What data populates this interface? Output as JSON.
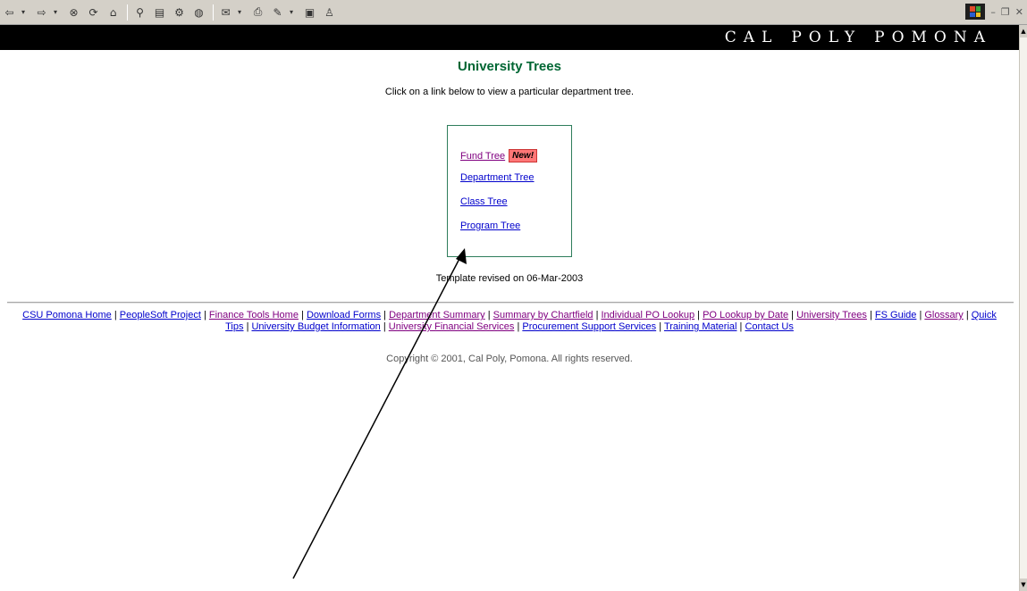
{
  "toolbar": {
    "icons": [
      "back-icon",
      "forward-icon",
      "stop-icon",
      "refresh-icon",
      "home-icon",
      "search-icon",
      "favorites-icon",
      "history-icon",
      "media-icon",
      "mail-icon",
      "print-icon",
      "edit-icon",
      "discuss-icon",
      "messenger-icon"
    ],
    "window_controls": {
      "minimize": "–",
      "restore": "❐",
      "close": "✕"
    }
  },
  "banner": {
    "words": [
      "CAL",
      "POLY",
      "POMONA"
    ]
  },
  "page": {
    "title": "University Trees",
    "intro": "Click on a link below to view a particular department tree.",
    "revised": "Template revised on 06-Mar-2003",
    "copyright": "Copyright © 2001, Cal Poly, Pomona. All rights reserved."
  },
  "trees": [
    {
      "label": "Fund Tree",
      "badge": "New!",
      "visited": true
    },
    {
      "label": "Department Tree",
      "badge": "",
      "visited": false
    },
    {
      "label": "Class Tree",
      "badge": "",
      "visited": false
    },
    {
      "label": "Program Tree",
      "badge": "",
      "visited": false
    }
  ],
  "footer": {
    "separator": "|",
    "links": [
      {
        "label": "CSU Pomona Home",
        "visited": false
      },
      {
        "label": "PeopleSoft Project",
        "visited": false
      },
      {
        "label": "Finance Tools Home",
        "visited": true
      },
      {
        "label": "Download Forms",
        "visited": false
      },
      {
        "label": "Department Summary",
        "visited": true
      },
      {
        "label": "Summary by Chartfield",
        "visited": true
      },
      {
        "label": "Individual PO Lookup",
        "visited": true
      },
      {
        "label": "PO Lookup by Date",
        "visited": true
      },
      {
        "label": "University Trees",
        "visited": true
      },
      {
        "label": "FS Guide",
        "visited": false
      },
      {
        "label": "Glossary",
        "visited": true
      },
      {
        "label": "Quick Tips",
        "visited": false
      },
      {
        "label": "University Budget Information",
        "visited": false
      },
      {
        "label": "University Financial Services",
        "visited": true
      },
      {
        "label": "Procurement Support Services",
        "visited": false
      },
      {
        "label": "Training Material",
        "visited": false
      },
      {
        "label": "Contact Us",
        "visited": false
      }
    ]
  },
  "colors": {
    "title_green": "#006633",
    "link_blue": "#0000cc",
    "link_visited": "#800080",
    "badge_red": "#ff7777",
    "banner_black": "#000000"
  }
}
